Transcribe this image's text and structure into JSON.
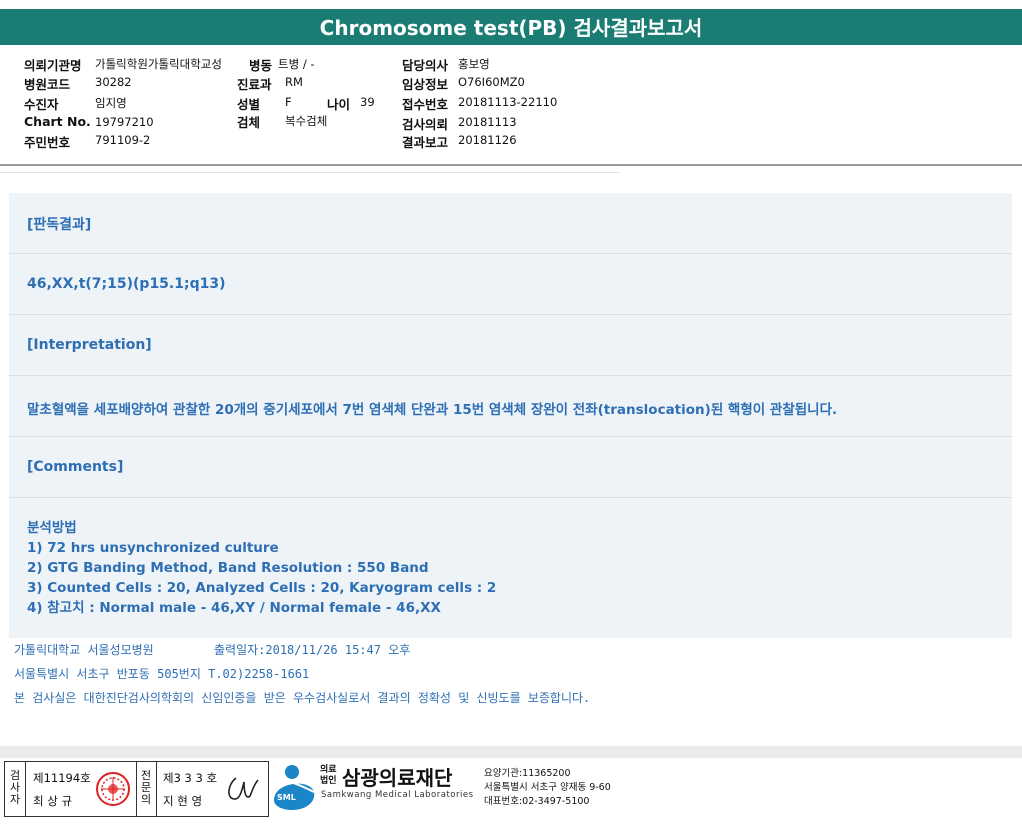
{
  "title": "Chromosome test(PB) 검사결과보고서",
  "header": {
    "institution_label": "의뢰기관명",
    "institution_value": "가톨릭학원가톨릭대학교성",
    "ward_label": "병동",
    "ward_value": "트병 / -",
    "hospital_code_label": "병원코드",
    "hospital_code_value": "30282",
    "dept_label": "진료과",
    "dept_value": "RM",
    "patient_label": "수진자",
    "patient_value": "임지영",
    "sex_label": "성별",
    "sex_value": "F",
    "age_label": "나이",
    "age_value": "39",
    "chart_label": "Chart No.",
    "chart_value": "19797210",
    "specimen_label": "검체",
    "specimen_value": "복수검체",
    "rrn_label": "주민번호",
    "rrn_value": "791109-2",
    "doctor_label": "담당의사",
    "doctor_value": "홍보영",
    "clinical_label": "임상정보",
    "clinical_value": "O76I60MZ0",
    "receipt_label": "접수번호",
    "receipt_value": "20181113-22110",
    "request_label": "검사의뢰",
    "request_value": "20181113",
    "report_label": "결과보고",
    "report_value": "20181126"
  },
  "result": {
    "reading_heading": "[판독결과]",
    "karyotype": "46,XX,t(7;15)(p15.1;q13)",
    "interpretation_heading": "[Interpretation]",
    "interpretation_text": "말초혈액을 세포배양하여 관찰한 20개의 중기세포에서 7번 염색체 단완과 15번 염색체 장완이 전좌(translocation)된 핵형이 관찰됩니다.",
    "comments_heading": "[Comments]",
    "method_heading": "분석방법",
    "method_items": [
      "1) 72 hrs unsynchronized culture",
      "2) GTG Banding Method, Band Resolution : 550 Band",
      "3) Counted Cells : 20, Analyzed Cells : 20, Karyogram cells : 2",
      "4) 참고치 : Normal male - 46,XY / Normal female - 46,XX"
    ]
  },
  "footer": {
    "hospital": "가톨릭대학교 서울성모병원",
    "print_date": "출력일자:2018/11/26 15:47 오후",
    "address": "서울특별시 서초구 반포동 505번지 T.02)2258-1661",
    "certification": "본 검사실은 대한진단검사의학회의 신임인증을 받은 우수검사실로서 결과의 정확성 및 신빙도를 보증합니다."
  },
  "signatures": {
    "inspector_vertical": [
      "검",
      "사",
      "자"
    ],
    "inspector_no": "제11194호",
    "inspector_name": "최 상 규",
    "specialist_vertical": [
      "전",
      "문",
      "의"
    ],
    "specialist_no": "제3 3 3 호",
    "specialist_name": "지 현 영"
  },
  "org": {
    "legal_small_1": "의료",
    "legal_small_2": "법인",
    "name": "삼광의료재단",
    "english": "Samkwang Medical Laboratories",
    "logo_abbr": "SML",
    "code_line": "요양기관:11365200",
    "address_line": "서울특별시 서초구 양재동 9-60",
    "phone_line": "대표번호:02-3497-5100"
  },
  "colors": {
    "title_bg": "#1b7c74",
    "accent_text": "#2e6fb4",
    "panel_bg": "#eef3f8",
    "logo_blue": "#1a86c7"
  }
}
